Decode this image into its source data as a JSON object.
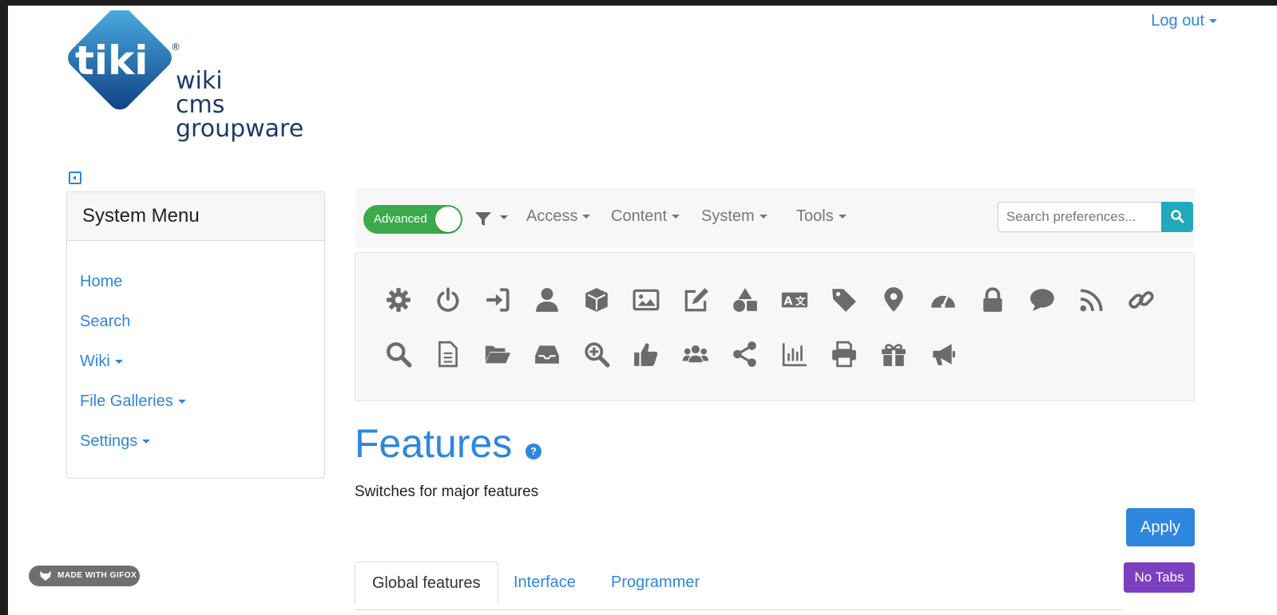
{
  "header": {
    "logo_mark": "tiki",
    "logo_words": [
      "wiki",
      "cms",
      "groupware"
    ],
    "logo_registered": "®",
    "logout_label": "Log out"
  },
  "sidebar": {
    "title": "System Menu",
    "items": [
      {
        "label": "Home",
        "has_dropdown": false
      },
      {
        "label": "Search",
        "has_dropdown": false
      },
      {
        "label": "Wiki",
        "has_dropdown": true
      },
      {
        "label": "File Galleries",
        "has_dropdown": true
      },
      {
        "label": "Settings",
        "has_dropdown": true
      }
    ]
  },
  "toolbar": {
    "toggle_label": "Advanced",
    "menus": [
      "Access",
      "Content",
      "System",
      "Tools"
    ],
    "search_placeholder": "Search preferences...",
    "search_value": ""
  },
  "icon_grid": {
    "row1": [
      "gear-icon",
      "power-icon",
      "sign-in-icon",
      "user-icon",
      "cube-icon",
      "image-icon",
      "edit-icon",
      "shapes-icon",
      "language-icon",
      "tag-icon",
      "map-marker-icon",
      "dashboard-icon",
      "lock-icon",
      "comment-icon",
      "rss-icon",
      "link-icon"
    ],
    "row2": [
      "search-icon",
      "file-icon",
      "folder-open-icon",
      "inbox-icon",
      "search-plus-icon",
      "thumbs-up-icon",
      "users-icon",
      "share-icon",
      "bar-chart-icon",
      "print-icon",
      "gift-icon",
      "bullhorn-icon"
    ]
  },
  "main": {
    "title": "Features",
    "subtitle": "Switches for major features",
    "apply_label": "Apply",
    "no_tabs_label": "No Tabs",
    "tabs": [
      "Global features",
      "Interface",
      "Programmer"
    ]
  },
  "watermark": {
    "label": "MADE WITH GIFOX"
  },
  "colors": {
    "link": "#2e86de",
    "toggle_on": "#3aaa4a",
    "search_button": "#22a8bb",
    "no_tabs_button": "#7b3fbf",
    "icon_gray": "#6b6b6b"
  }
}
